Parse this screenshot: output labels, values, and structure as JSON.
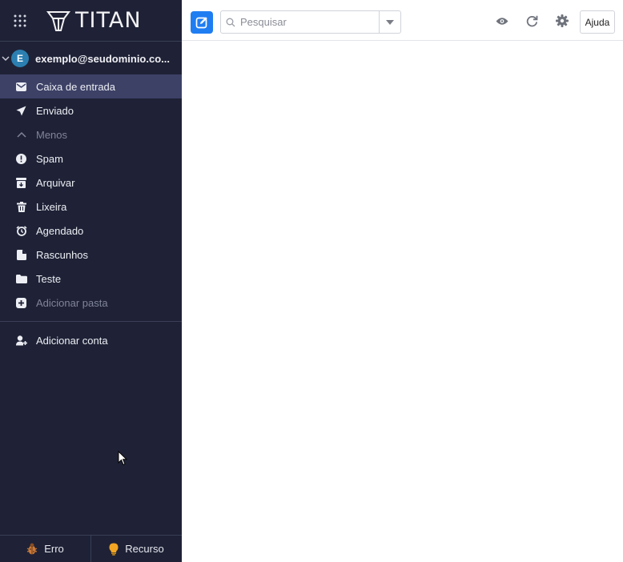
{
  "app": {
    "brand": "TITAN"
  },
  "account": {
    "avatar_letter": "E",
    "email": "exemplo@seudominio.co..."
  },
  "folders": [
    {
      "label": "Caixa de entrada",
      "icon": "envelope-icon",
      "active": true
    },
    {
      "label": "Enviado",
      "icon": "paper-plane-icon"
    },
    {
      "label": "Menos",
      "icon": "chevron-up-icon",
      "muted": true
    },
    {
      "label": "Spam",
      "icon": "exclamation-circle-icon"
    },
    {
      "label": "Arquivar",
      "icon": "archive-icon"
    },
    {
      "label": "Lixeira",
      "icon": "trash-icon"
    },
    {
      "label": "Agendado",
      "icon": "alarm-clock-icon"
    },
    {
      "label": "Rascunhos",
      "icon": "draft-icon"
    },
    {
      "label": "Teste",
      "icon": "folder-icon"
    },
    {
      "label": "Adicionar pasta",
      "icon": "plus-square-icon",
      "muted": true
    }
  ],
  "add_account": {
    "label": "Adicionar conta"
  },
  "footer": {
    "bug_label": "Erro",
    "feature_label": "Recurso"
  },
  "topbar": {
    "search_placeholder": "Pesquisar",
    "help_label": "Ajuda"
  },
  "colors": {
    "sidebar_bg": "#1f2236",
    "active_item_bg": "#3d4166",
    "compose_blue": "#1f7df2",
    "avatar_bg": "#2b7fb1"
  }
}
